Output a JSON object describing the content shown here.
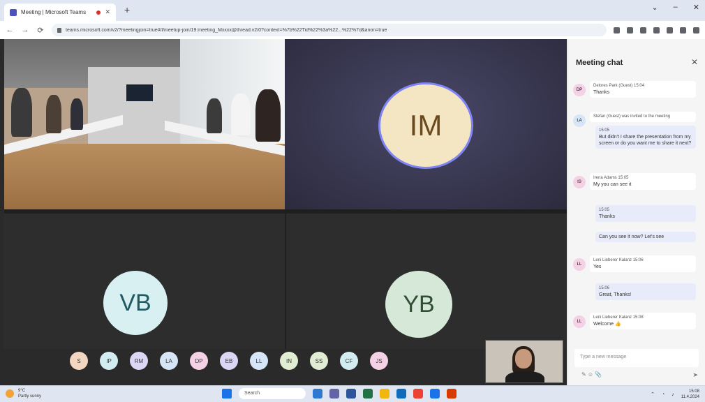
{
  "browser": {
    "tab_title": "Meeting | Microsoft Teams",
    "new_tab": "+",
    "window_controls": [
      "⌄",
      "–",
      "✕"
    ],
    "url": "teams.microsoft.com/v2/?meetingjoin=true#/l/meetup-join/19:meeting_Mxxxx@thread.v2/0?context=%7b%22Tid%22%3a%22...%22%7d&anon=true",
    "nav": [
      "←",
      "→",
      "⟳"
    ]
  },
  "stage": {
    "tiles": [
      {
        "name": "room",
        "initials": ""
      },
      {
        "name": "im",
        "initials": "IM"
      },
      {
        "name": "vb",
        "initials": "VB"
      },
      {
        "name": "yb",
        "initials": "YB"
      }
    ],
    "participants": [
      {
        "initials": "S",
        "color": "#f3d6c1"
      },
      {
        "initials": "IP",
        "color": "#d3ecf1"
      },
      {
        "initials": "RM",
        "color": "#dcd6f5"
      },
      {
        "initials": "LA",
        "color": "#d6e6f7"
      },
      {
        "initials": "DP",
        "color": "#f5d1e6"
      },
      {
        "initials": "EB",
        "color": "#dcd6f5"
      },
      {
        "initials": "LL",
        "color": "#d6e6f7"
      },
      {
        "initials": "IN",
        "color": "#e1edd3"
      },
      {
        "initials": "SS",
        "color": "#e1edd3"
      },
      {
        "initials": "CF",
        "color": "#d3ecf1"
      },
      {
        "initials": "JS",
        "color": "#f5d1e6"
      }
    ]
  },
  "chat": {
    "title": "Meeting chat",
    "close": "✕",
    "messages": [
      {
        "initials": "DP",
        "avcolor": "#f5d1e6",
        "who": "Delores Park (Guest)  15:04",
        "text": "Thanks",
        "mine": false
      },
      {
        "initials": "LA",
        "avcolor": "#d6e6f7",
        "who": "Stefan (Guest) was invited to the meeting",
        "text": "",
        "mine": false
      },
      {
        "initials": "",
        "avcolor": "",
        "who": "15:05",
        "text": "But didn't I share the presentation from my screen or do you want me to share it next?",
        "mine": true
      },
      {
        "initials": "IS",
        "avcolor": "#f5d1e6",
        "who": "Irena Adams  15:05",
        "text": "My you can see it",
        "mine": false
      },
      {
        "initials": "",
        "avcolor": "",
        "who": "15:05",
        "text": "Thanks",
        "mine": true
      },
      {
        "initials": "",
        "avcolor": "",
        "who": "",
        "text": "Can you see it now? Let's see",
        "mine": true
      },
      {
        "initials": "LL",
        "avcolor": "#f5d1e6",
        "who": "Leni Lieberer Kalanz  15:06",
        "text": "Yes",
        "mine": false
      },
      {
        "initials": "",
        "avcolor": "",
        "who": "15:06",
        "text": "Great, Thanks!",
        "mine": true
      },
      {
        "initials": "LL",
        "avcolor": "#f5d1e6",
        "who": "Leni Lieberer Kalanz  15:08",
        "text": "Welcome 👍",
        "mine": false
      }
    ],
    "input_placeholder": "Type a new message",
    "tools": "✎ ☺ 📎",
    "send": "➤"
  },
  "taskbar": {
    "weather_temp": "9°C",
    "weather_desc": "Partly sunny",
    "search": "Search",
    "apps": [
      "#2e7ad1",
      "#6264a7",
      "#2b579a",
      "#217346",
      "#f2b611",
      "#0f6cbd",
      "#ea4335",
      "#1a73e8",
      "#d83b01"
    ],
    "time": "15:08",
    "date": "11.4.2024"
  }
}
